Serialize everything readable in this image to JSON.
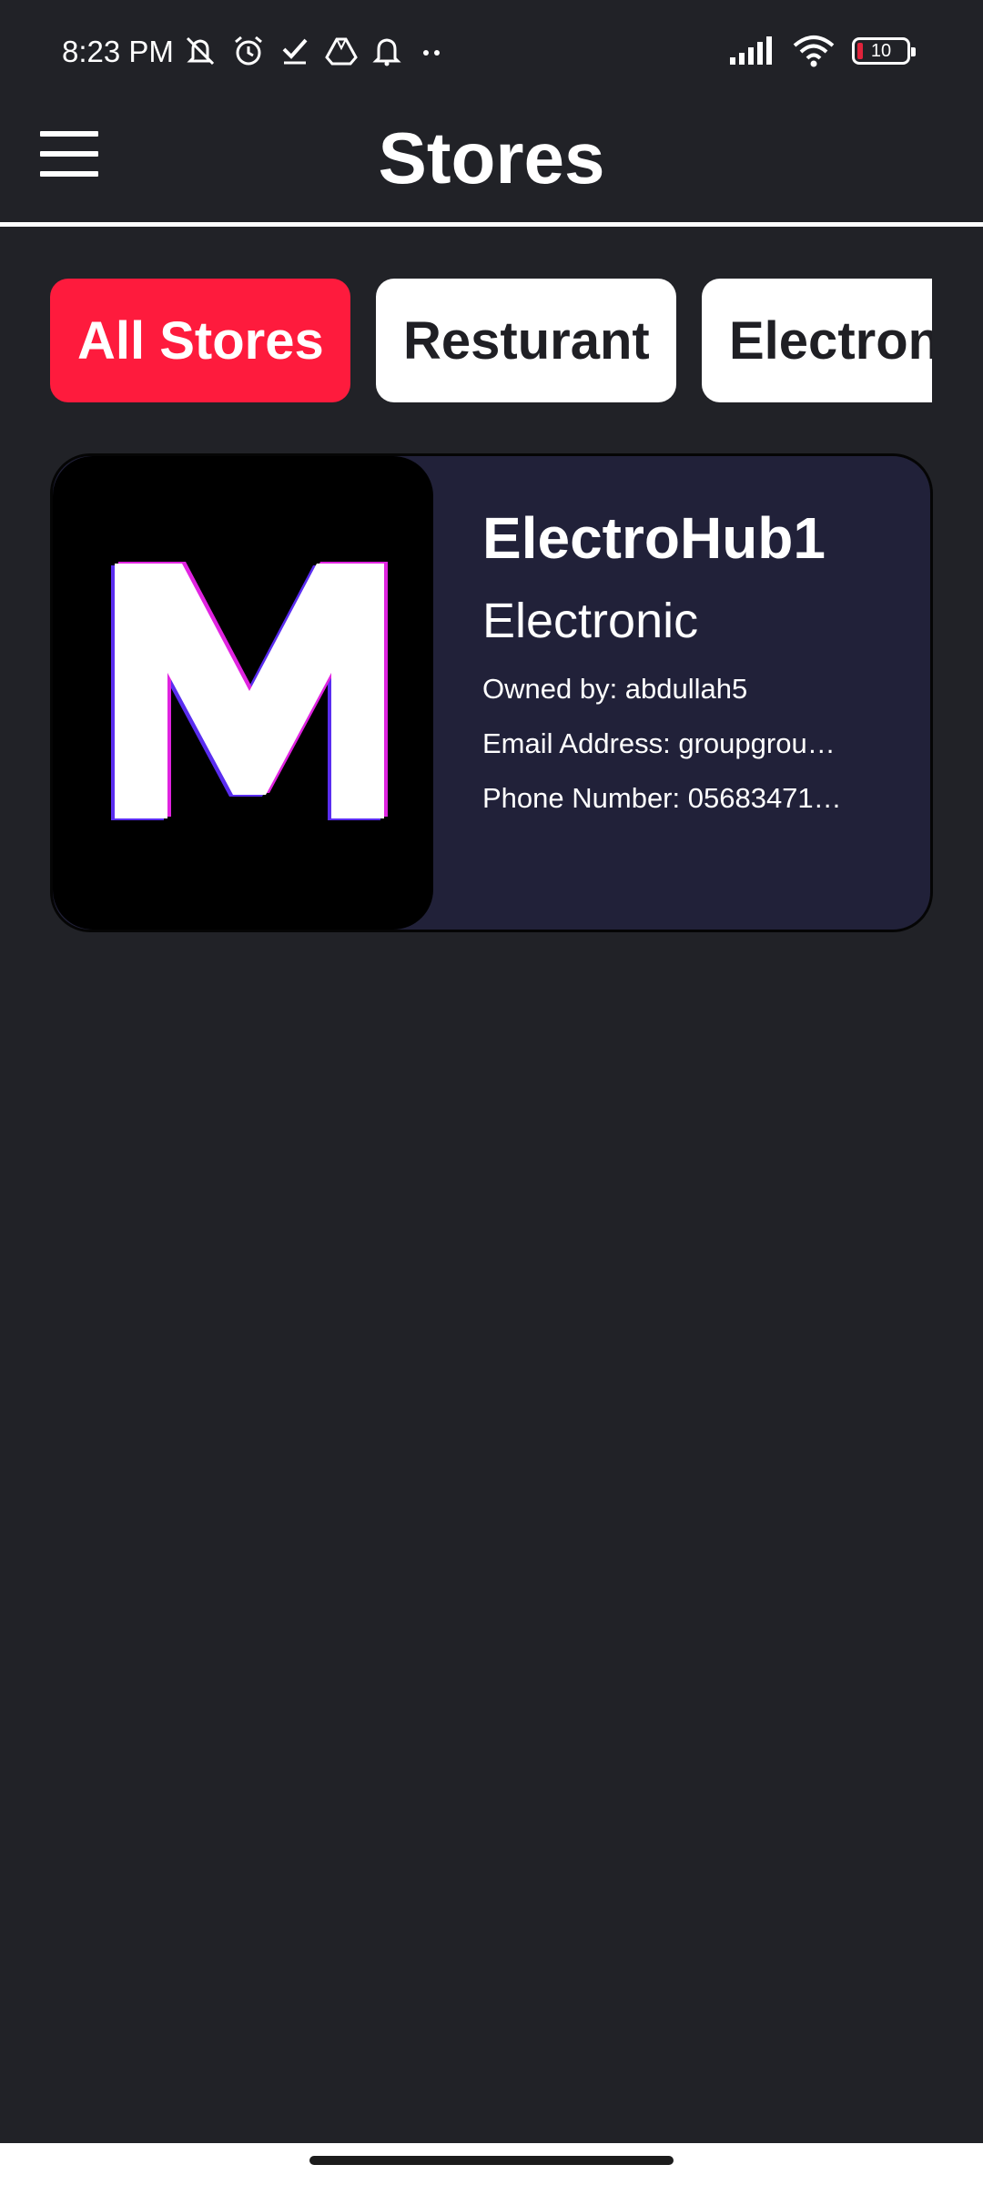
{
  "status_bar": {
    "time": "8:23 PM",
    "battery_level": "10",
    "icons": [
      "mute-icon",
      "alarm-icon",
      "check-icon",
      "drive-icon",
      "bell-icon",
      "more-dots-icon",
      "signal-icon",
      "wifi-icon",
      "battery-icon"
    ]
  },
  "header": {
    "title": "Stores",
    "menu_icon": "hamburger-menu-icon"
  },
  "categories": [
    {
      "label": "All Stores",
      "selected": true
    },
    {
      "label": "Resturant",
      "selected": false
    },
    {
      "label": "Electron",
      "selected": false
    }
  ],
  "stores": [
    {
      "name": "ElectroHub1",
      "category": "Electronic",
      "owner": "Owned by: abdullah5",
      "email": "Email Address: groupgrou…",
      "phone": "Phone Number: 05683471…",
      "logo_letter": "M"
    }
  ],
  "colors": {
    "background": "#212227",
    "accent": "#fe1b3d",
    "card": "#212139",
    "chip_inactive": "#ffffff"
  }
}
